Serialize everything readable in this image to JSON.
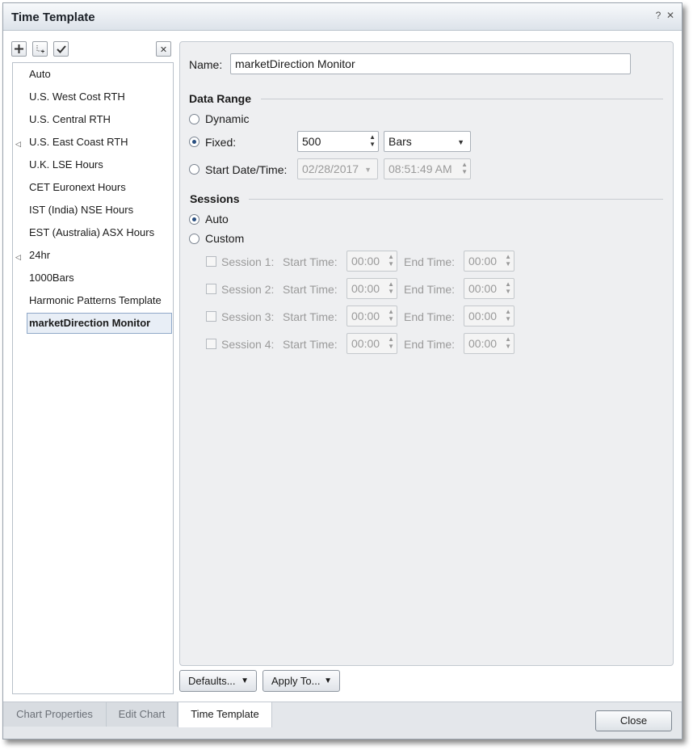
{
  "window": {
    "title": "Time Template",
    "help_glyph": "?",
    "close_glyph": "✕"
  },
  "toolbar": {
    "add": "+",
    "copy": "copy",
    "apply": "check",
    "delete": "✕"
  },
  "templates": [
    {
      "label": "Auto",
      "expander": false,
      "selected": false
    },
    {
      "label": "U.S. West Cost RTH",
      "expander": false,
      "selected": false
    },
    {
      "label": "U.S. Central RTH",
      "expander": false,
      "selected": false
    },
    {
      "label": "U.S. East Coast RTH",
      "expander": true,
      "selected": false
    },
    {
      "label": "U.K. LSE Hours",
      "expander": false,
      "selected": false
    },
    {
      "label": "CET Euronext Hours",
      "expander": false,
      "selected": false
    },
    {
      "label": "IST (India) NSE Hours",
      "expander": false,
      "selected": false
    },
    {
      "label": "EST (Australia) ASX Hours",
      "expander": false,
      "selected": false
    },
    {
      "label": "24hr",
      "expander": true,
      "selected": false
    },
    {
      "label": "1000Bars",
      "expander": false,
      "selected": false
    },
    {
      "label": "Harmonic Patterns Template",
      "expander": false,
      "selected": false
    },
    {
      "label": "marketDirection Monitor",
      "expander": false,
      "selected": true
    }
  ],
  "expander_glyph": "◁",
  "form": {
    "name_label": "Name:",
    "name_value": "marketDirection Monitor",
    "data_range": {
      "title": "Data Range",
      "dynamic_label": "Dynamic",
      "fixed_label": "Fixed:",
      "fixed_value": "500",
      "unit_value": "Bars",
      "start_label": "Start Date/Time:",
      "start_date": "02/28/2017",
      "start_time": "08:51:49 AM",
      "selected": "fixed"
    },
    "sessions": {
      "title": "Sessions",
      "auto_label": "Auto",
      "custom_label": "Custom",
      "selected": "auto",
      "start_time_label": "Start Time:",
      "end_time_label": "End Time:",
      "rows": [
        {
          "label": "Session 1:",
          "start": "00:00",
          "end": "00:00"
        },
        {
          "label": "Session 2:",
          "start": "00:00",
          "end": "00:00"
        },
        {
          "label": "Session 3:",
          "start": "00:00",
          "end": "00:00"
        },
        {
          "label": "Session 4:",
          "start": "00:00",
          "end": "00:00"
        }
      ]
    }
  },
  "buttons": {
    "defaults": "Defaults...",
    "apply_to": "Apply To...",
    "close": "Close",
    "dropdown_glyph": "▼"
  },
  "tabs": [
    {
      "label": "Chart Properties",
      "active": false
    },
    {
      "label": "Edit Chart",
      "active": false
    },
    {
      "label": "Time Template",
      "active": true
    }
  ],
  "colors": {
    "accent": "#2a4f80",
    "selection_bg": "#e8eef6",
    "panel_bg": "#eeeff1"
  }
}
